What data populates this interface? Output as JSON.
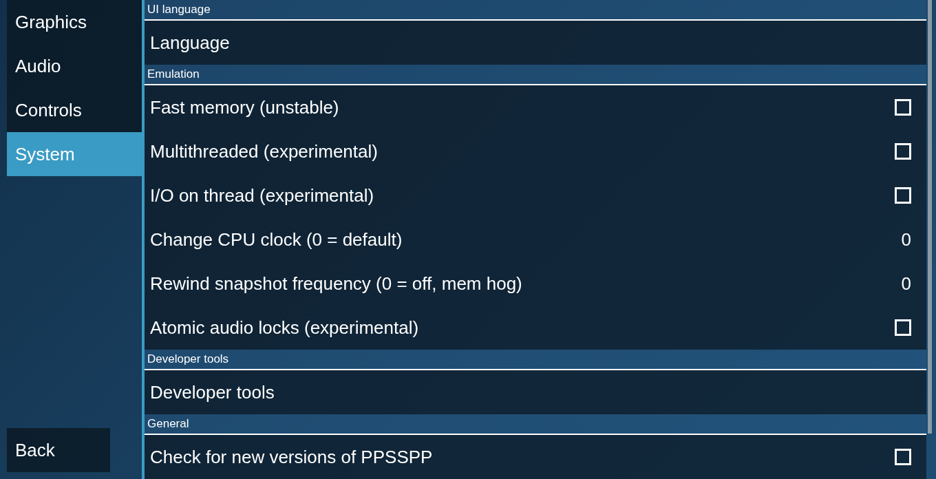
{
  "tabs": [
    {
      "label": "Graphics",
      "selected": false
    },
    {
      "label": "Audio",
      "selected": false
    },
    {
      "label": "Controls",
      "selected": false
    },
    {
      "label": "System",
      "selected": true
    }
  ],
  "back_button": "Back",
  "sections": [
    {
      "title": "UI language",
      "items": [
        {
          "kind": "choice",
          "label": "Language"
        }
      ]
    },
    {
      "title": "Emulation",
      "items": [
        {
          "kind": "checkbox",
          "label": "Fast memory (unstable)",
          "checked": false
        },
        {
          "kind": "checkbox",
          "label": "Multithreaded (experimental)",
          "checked": false
        },
        {
          "kind": "checkbox",
          "label": "I/O on thread (experimental)",
          "checked": false
        },
        {
          "kind": "value",
          "label": "Change CPU clock (0 = default)",
          "value": "0"
        },
        {
          "kind": "value",
          "label": "Rewind snapshot frequency (0 = off, mem hog)",
          "value": "0"
        },
        {
          "kind": "checkbox",
          "label": "Atomic audio locks (experimental)",
          "checked": false
        }
      ]
    },
    {
      "title": "Developer tools",
      "items": [
        {
          "kind": "choice",
          "label": "Developer tools"
        }
      ]
    },
    {
      "title": "General",
      "items": [
        {
          "kind": "checkbox",
          "label": "Check for new versions of PPSSPP",
          "checked": false
        }
      ]
    }
  ]
}
